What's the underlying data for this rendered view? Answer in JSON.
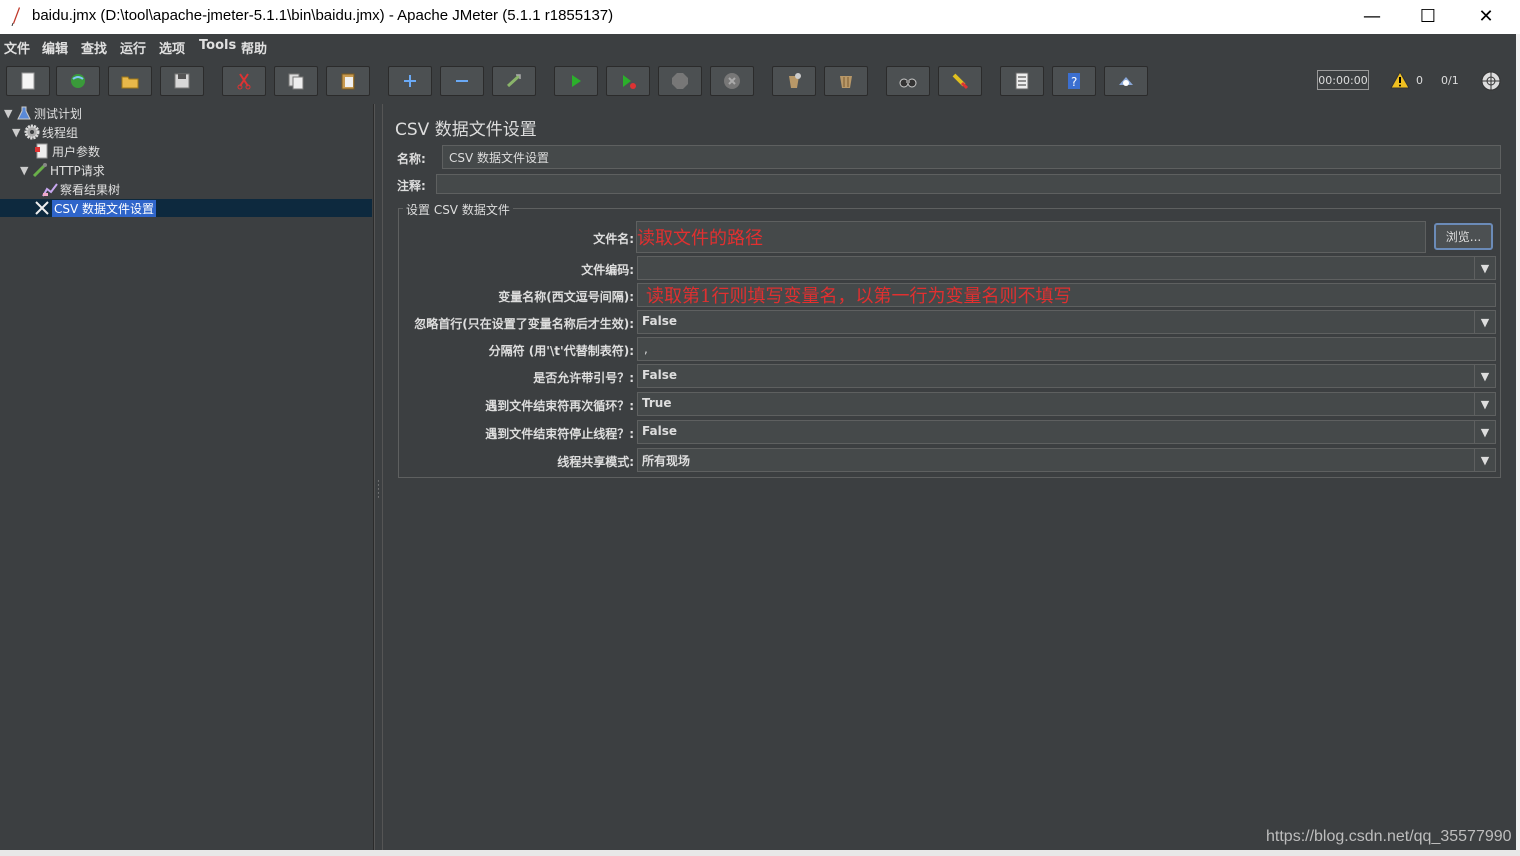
{
  "window": {
    "title": "baidu.jmx (D:\\tool\\apache-jmeter-5.1.1\\bin\\baidu.jmx) - Apache JMeter (5.1.1 r1855137)",
    "minimize": "—",
    "maximize": "☐",
    "close": "✕"
  },
  "menu": [
    "文件",
    "编辑",
    "查找",
    "运行",
    "选项",
    "Tools",
    "帮助"
  ],
  "toolbar": {
    "icons": [
      "new-icon",
      "templates-icon",
      "open-icon",
      "save-icon",
      "cut-icon",
      "copy-icon",
      "paste-icon",
      "expand-icon",
      "collapse-icon",
      "toggle-icon",
      "start-icon",
      "start-no-pause-icon",
      "stop-icon",
      "shutdown-icon",
      "clear-icon",
      "clear-all-icon",
      "search-icon",
      "reset-search-icon",
      "function-helper-icon",
      "help-icon",
      "remote-icon"
    ],
    "timer": "00:00:00",
    "warnings": "0",
    "threads": "0/1"
  },
  "tree": {
    "items": [
      {
        "label": "测试计划",
        "icon": "flask-icon",
        "expanded": true
      },
      {
        "label": "线程组",
        "icon": "gear-icon",
        "expanded": true
      },
      {
        "label": "用户参数",
        "icon": "preprocessor-icon"
      },
      {
        "label": "HTTP请求",
        "icon": "pipette-icon",
        "expanded": true
      },
      {
        "label": "察看结果树",
        "icon": "chart-icon"
      },
      {
        "label": "CSV 数据文件设置",
        "icon": "tools-icon",
        "selected": true
      }
    ]
  },
  "panel": {
    "title": "CSV 数据文件设置",
    "name_label": "名称:",
    "name_value": "CSV 数据文件设置",
    "comment_label": "注释:",
    "comment_value": "",
    "group_title": "设置 CSV 数据文件",
    "fields": {
      "filename_label": "文件名:",
      "filename_value": "读取文件的路径",
      "browse": "浏览...",
      "encoding_label": "文件编码:",
      "encoding_value": "",
      "varnames_label": "变量名称(西文逗号间隔):",
      "varnames_value": "读取第1行则填写变量名，以第一行为变量名则不填写",
      "ignore_first_label": "忽略首行(只在设置了变量名称后才生效):",
      "ignore_first_value": "False",
      "delimiter_label": "分隔符 (用'\\t'代替制表符):",
      "delimiter_value": ",",
      "quoted_label": "是否允许带引号？:",
      "quoted_value": "False",
      "recycle_label": "遇到文件结束符再次循环？:",
      "recycle_value": "True",
      "stop_thread_label": "遇到文件结束符停止线程？:",
      "stop_thread_value": "False",
      "sharing_label": "线程共享模式:",
      "sharing_value": "所有现场"
    }
  },
  "watermark": "https://blog.csdn.net/qq_35577990"
}
